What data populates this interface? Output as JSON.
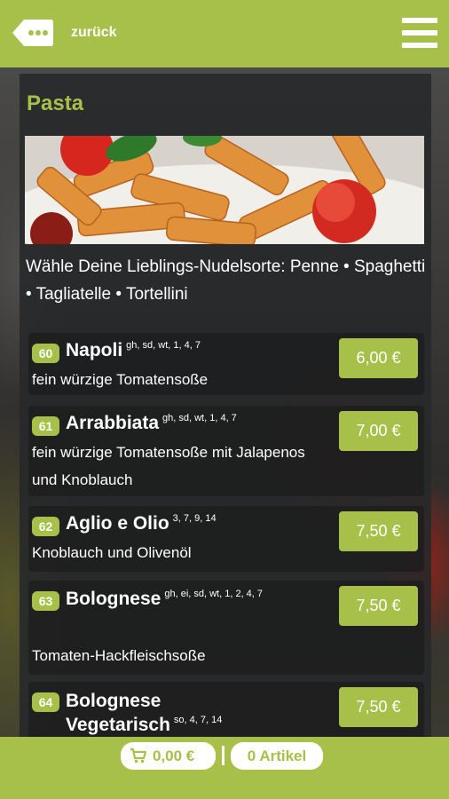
{
  "colors": {
    "accent": "#a6c04a",
    "panel": "#26282a",
    "text": "#ffffff"
  },
  "header": {
    "back_icon": "ellipsis-bubble-back-icon",
    "back_label": "zurück",
    "menu_icon": "hamburger-menu-icon"
  },
  "category": {
    "title": "Pasta",
    "hero_image": "pasta-penne-with-tomatoes-photo",
    "description": "Wähle Deine Lieblings-Nudelsorte: Penne • Spaghetti • Tagliatelle • Tortellini"
  },
  "items": [
    {
      "number": "60",
      "name": "Napoli",
      "allergens": "gh, sd, wt, 1, 4, 7",
      "description": "fein würzige Tomatensoße",
      "price": "6,00 €"
    },
    {
      "number": "61",
      "name": "Arrabbiata",
      "allergens": "gh, sd, wt, 1, 4, 7",
      "description": "fein würzige Tomatensoße mit Jalapenos und Knoblauch",
      "price": "7,00 €"
    },
    {
      "number": "62",
      "name": "Aglio e Olio",
      "allergens": "3, 7, 9, 14",
      "description": "Knoblauch und Olivenöl",
      "price": "7,50 €"
    },
    {
      "number": "63",
      "name": "Bolognese",
      "allergens": "gh, ei, sd, wt, 1, 2, 4, 7",
      "description": "Tomaten-Hackfleischsoße",
      "price": "7,50 €"
    },
    {
      "number": "64",
      "name": "Bolognese Vegetarisch",
      "allergens": "so, 4, 7, 14",
      "description": "",
      "price": "7,50 €"
    }
  ],
  "footer": {
    "cart_icon": "shopping-cart-icon",
    "cart_total": "0,00 €",
    "article_count": "0 Artikel"
  }
}
